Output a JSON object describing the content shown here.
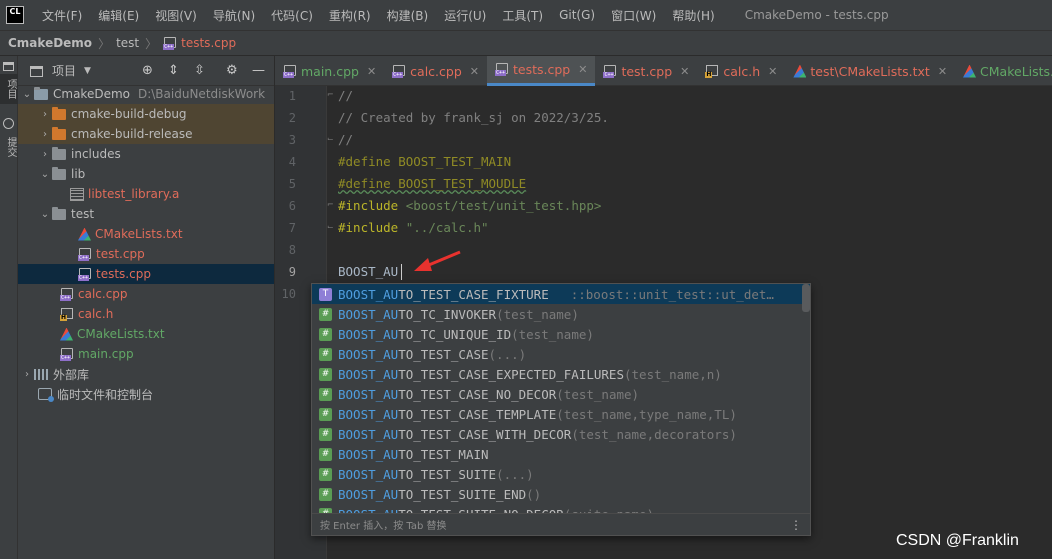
{
  "app": {
    "logo": "CL",
    "window_title": "CmakeDemo - tests.cpp"
  },
  "menu": [
    "文件(F)",
    "编辑(E)",
    "视图(V)",
    "导航(N)",
    "代码(C)",
    "重构(R)",
    "构建(B)",
    "运行(U)",
    "工具(T)",
    "Git(G)",
    "窗口(W)",
    "帮助(H)"
  ],
  "breadcrumb": {
    "project": "CmakeDemo",
    "folder": "test",
    "file": "tests.cpp"
  },
  "left_strip": {
    "project_tab": "项目",
    "commit_tab": "提交"
  },
  "project_panel": {
    "title": "项目",
    "root": {
      "name": "CmakeDemo",
      "path": "D:\\BaiduNetdiskWork"
    },
    "items": [
      {
        "label": "cmake-build-debug"
      },
      {
        "label": "cmake-build-release"
      },
      {
        "label": "includes"
      },
      {
        "label": "lib"
      },
      {
        "label": "libtest_library.a"
      },
      {
        "label": "test"
      },
      {
        "label": "CMakeLists.txt"
      },
      {
        "label": "test.cpp"
      },
      {
        "label": "tests.cpp"
      },
      {
        "label": "calc.cpp"
      },
      {
        "label": "calc.h"
      },
      {
        "label": "CMakeLists.txt"
      },
      {
        "label": "main.cpp"
      },
      {
        "label": "外部库"
      },
      {
        "label": "临时文件和控制台"
      }
    ]
  },
  "tabs": [
    {
      "label": "main.cpp",
      "icon": "cpp-file-icon"
    },
    {
      "label": "calc.cpp",
      "icon": "cpp-file-icon"
    },
    {
      "label": "tests.cpp",
      "icon": "cpp-file-icon",
      "active": true
    },
    {
      "label": "test.cpp",
      "icon": "cpp-file-icon"
    },
    {
      "label": "calc.h",
      "icon": "header-file-icon"
    },
    {
      "label": "test\\CMakeLists.txt",
      "icon": "cmake-icon"
    },
    {
      "label": "CMakeLists.txt",
      "icon": "cmake-icon"
    }
  ],
  "editor": {
    "line_numbers": [
      "1",
      "2",
      "3",
      "4",
      "5",
      "6",
      "7",
      "8",
      "9",
      "10"
    ],
    "current_line": 9,
    "lines": {
      "l1": "//",
      "l2": "// Created by frank_sj on 2022/3/25.",
      "l3": "//",
      "l4": "#define BOOST_TEST_MAIN",
      "l5": "#define BOOST_TEST_MOUDLE",
      "l6_directive": "#include",
      "l6_string": "<boost/test/unit_test.hpp>",
      "l7_directive": "#include",
      "l7_string": "\"../calc.h\"",
      "l9": "BOOST_AU"
    }
  },
  "completion": {
    "typed_prefix": "BOOST_AU",
    "items": [
      {
        "kind": "T",
        "match": "BOOST_AU",
        "rest": "TO_TEST_CASE_FIXTURE",
        "sig": "",
        "tail": "::boost::unit_test::ut_det…"
      },
      {
        "kind": "#",
        "match": "BOOST_AU",
        "rest": "TO_TC_INVOKER",
        "sig": "(test_name)",
        "tail": ""
      },
      {
        "kind": "#",
        "match": "BOOST_AU",
        "rest": "TO_TC_UNIQUE_ID",
        "sig": "(test_name)",
        "tail": ""
      },
      {
        "kind": "#",
        "match": "BOOST_AU",
        "rest": "TO_TEST_CASE",
        "sig": "(...)",
        "tail": ""
      },
      {
        "kind": "#",
        "match": "BOOST_AU",
        "rest": "TO_TEST_CASE_EXPECTED_FAILURES",
        "sig": "(test_name,n)",
        "tail": ""
      },
      {
        "kind": "#",
        "match": "BOOST_AU",
        "rest": "TO_TEST_CASE_NO_DECOR",
        "sig": "(test_name)",
        "tail": ""
      },
      {
        "kind": "#",
        "match": "BOOST_AU",
        "rest": "TO_TEST_CASE_TEMPLATE",
        "sig": "(test_name,type_name,TL)",
        "tail": ""
      },
      {
        "kind": "#",
        "match": "BOOST_AU",
        "rest": "TO_TEST_CASE_WITH_DECOR",
        "sig": "(test_name,decorators)",
        "tail": ""
      },
      {
        "kind": "#",
        "match": "BOOST_AU",
        "rest": "TO_TEST_MAIN",
        "sig": "",
        "tail": ""
      },
      {
        "kind": "#",
        "match": "BOOST_AU",
        "rest": "TO_TEST_SUITE",
        "sig": "(...)",
        "tail": ""
      },
      {
        "kind": "#",
        "match": "BOOST_AU",
        "rest": "TO_TEST_SUITE_END",
        "sig": "()",
        "tail": ""
      },
      {
        "kind": "#",
        "match": "BOOST_AU",
        "rest": "TO_TEST_SUITE_NO_DECOR",
        "sig": "(suite_name)",
        "tail": ""
      }
    ],
    "footer_hint": "按 Enter 插入，按 Tab 替换"
  },
  "watermark": "CSDN @Franklin",
  "colors": {
    "accent": "#4a88c7",
    "excluded_folder": "#d1782d",
    "modified_file": "#e06c5a",
    "added_file": "#62a866",
    "annotation_arrow": "#e8322e"
  }
}
